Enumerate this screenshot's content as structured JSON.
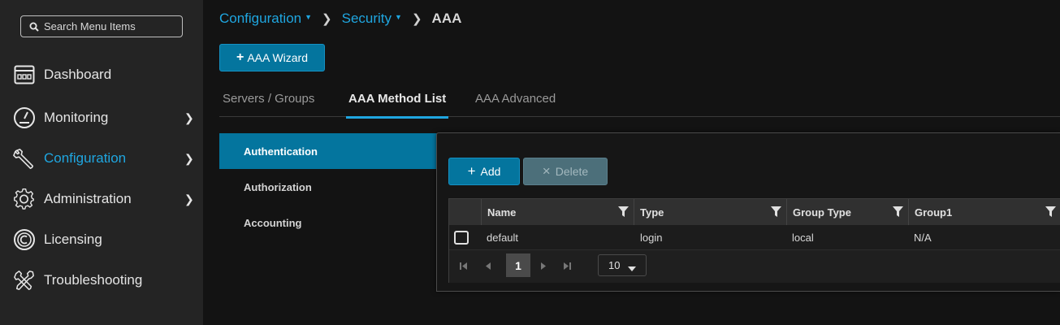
{
  "sidebar": {
    "search_placeholder": "Search Menu Items",
    "items": [
      {
        "label": "Dashboard",
        "icon": "dashboard-icon"
      },
      {
        "label": "Monitoring",
        "icon": "gauge-icon",
        "chevron": true
      },
      {
        "label": "Configuration",
        "icon": "wrench-icon",
        "chevron": true,
        "active": true
      },
      {
        "label": "Administration",
        "icon": "gear-icon",
        "chevron": true
      },
      {
        "label": "Licensing",
        "icon": "licensing-icon"
      },
      {
        "label": "Troubleshooting",
        "icon": "tools-icon"
      }
    ]
  },
  "breadcrumb": {
    "items": [
      "Configuration",
      "Security"
    ],
    "current": "AAA"
  },
  "wizard_button": "AAA Wizard",
  "tabs": [
    {
      "label": "Servers / Groups"
    },
    {
      "label": "AAA Method List",
      "active": true
    },
    {
      "label": "AAA Advanced"
    }
  ],
  "subnav": [
    {
      "label": "Authentication",
      "active": true
    },
    {
      "label": "Authorization"
    },
    {
      "label": "Accounting"
    }
  ],
  "toolbar": {
    "add_label": "Add",
    "delete_label": "Delete"
  },
  "table": {
    "columns": [
      "Name",
      "Type",
      "Group Type",
      "Group1"
    ],
    "rows": [
      [
        "default",
        "login",
        "local",
        "N/A"
      ]
    ]
  },
  "pager": {
    "current_page": "1",
    "page_size": "10"
  },
  "colors": {
    "accent": "#1fa6e0",
    "primary_button": "#04759e",
    "sidebar_bg": "#242424",
    "page_bg": "#131313"
  }
}
